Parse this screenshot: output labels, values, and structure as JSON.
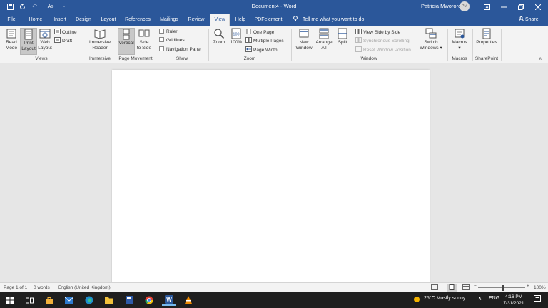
{
  "window": {
    "title": "Document4 - Word",
    "user_name": "Patricia Mwororo",
    "user_initials": "PM"
  },
  "tabs": [
    {
      "label": "File"
    },
    {
      "label": "Home"
    },
    {
      "label": "Insert"
    },
    {
      "label": "Design"
    },
    {
      "label": "Layout"
    },
    {
      "label": "References"
    },
    {
      "label": "Mailings"
    },
    {
      "label": "Review"
    },
    {
      "label": "View"
    },
    {
      "label": "Help"
    },
    {
      "label": "PDFelement"
    }
  ],
  "tell_me": "Tell me what you want to do",
  "share_label": "Share",
  "ribbon": {
    "views": {
      "label": "Views",
      "read_mode": "Read Mode",
      "read_mode_1": "Read",
      "read_mode_2": "Mode",
      "print_layout_1": "Print",
      "print_layout_2": "Layout",
      "web_layout_1": "Web",
      "web_layout_2": "Layout",
      "outline": "Outline",
      "draft": "Draft"
    },
    "immersive": {
      "label": "Immersive",
      "reader_1": "Immersive",
      "reader_2": "Reader"
    },
    "page_movement": {
      "label": "Page Movement",
      "vertical": "Vertical",
      "side_1": "Side",
      "side_2": "to Side"
    },
    "show": {
      "label": "Show",
      "ruler": "Ruler",
      "gridlines": "Gridlines",
      "nav_pane": "Navigation Pane"
    },
    "zoom": {
      "label": "Zoom",
      "zoom": "Zoom",
      "hundred": "100%",
      "one_page": "One Page",
      "multiple_pages": "Multiple Pages",
      "page_width": "Page Width"
    },
    "window": {
      "label": "Window",
      "new_1": "New",
      "new_2": "Window",
      "arrange_1": "Arrange",
      "arrange_2": "All",
      "split": "Split",
      "side_by_side": "View Side by Side",
      "sync_scroll": "Synchronous Scrolling",
      "reset_pos": "Reset Window Position",
      "switch_1": "Switch",
      "switch_2": "Windows"
    },
    "macros": {
      "label": "Macros",
      "macros": "Macros"
    },
    "sharepoint": {
      "label": "SharePoint",
      "properties": "Properties"
    }
  },
  "statusbar": {
    "page": "Page 1 of 1",
    "words": "0 words",
    "language": "English (United Kingdom)",
    "zoom": "100%"
  },
  "taskbar": {
    "weather": "25°C  Mostly sunny",
    "lang": "ENG",
    "time": "4:16 PM",
    "date": "7/31/2021"
  },
  "colors": {
    "word_blue": "#2b579a",
    "ribbon_bg": "#f3f3f3",
    "canvas_bg": "#e6e6e6",
    "taskbar_bg": "#1f1f1f"
  }
}
